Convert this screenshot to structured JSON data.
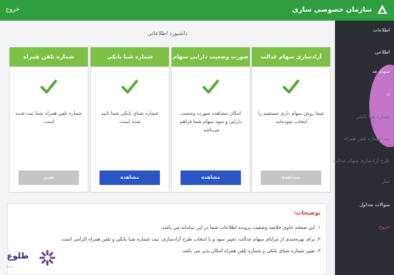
{
  "header": {
    "brand": "سازمان خصوصی سازی",
    "exit": "خروج"
  },
  "sidebar": {
    "items": [
      {
        "label": "اطلاعات",
        "tone": "bright"
      },
      {
        "label": "اطلاعی",
        "tone": "bright"
      },
      {
        "label": "سهام عد",
        "tone": "bright"
      },
      {
        "label": "ن",
        "tone": "bright"
      },
      {
        "label": "شماره شبا بانکی",
        "tone": "dim"
      },
      {
        "label": "ثبت شماره تلفن همراه",
        "tone": "dim"
      },
      {
        "label": "طرح آزادسازی سهام عدالت",
        "tone": "dim"
      },
      {
        "label": "ساز",
        "tone": "dim"
      },
      {
        "label": "سوالات متداول",
        "tone": "bright"
      },
      {
        "label": "خروج",
        "tone": "red"
      }
    ]
  },
  "main": {
    "title": "داشبورد اطلاعاتی",
    "cards": [
      {
        "title": "آزادسازی سهام عدالت",
        "text": "شما روش سهام داری مستقیم را انتخاب نموده‌اید.",
        "button": "مشاهده",
        "button_state": "disabled"
      },
      {
        "title": "صورت وضعیت دارایی سهام",
        "text": "امکان مشاهده صورت وضعیت دارایی و سود سهام شما فراهم می‌باشد.",
        "button": "مشاهده",
        "button_state": "active"
      },
      {
        "title": "شماره شبا بانکی",
        "text": "شماره شبای بانکی شما تایید شده است.",
        "button": "مشاهده",
        "button_state": "active"
      },
      {
        "title": "شماره تلفن همراه",
        "text": "شماره تلفن همراه شما ثبت شده است.",
        "button": "تغییر",
        "button_state": "disabled"
      }
    ],
    "notes": {
      "title": "توضیحات:",
      "lines": [
        "۱. این صفحه حاوی خلاصه وضعیت پرونده اطلاعات شما در این سامانه می باشد.",
        "۲. برای بهره‌مندی از مزایای سهام عدالت، تغییر سود و یا انتخاب طرح آزادسازی، ثبت شماره شبا بانکی و تلفن همراه الزامی است.",
        "۳. تغییر شماره شبای بانکی و شماره تلفن همراه امکان پذیر می باشد."
      ]
    }
  },
  "watermark": {
    "name": "طلوع",
    "subtitle": "پدیده"
  },
  "colors": {
    "header": "#2e9e3f",
    "card_header": "#7cc046",
    "primary_button": "#2a55c2",
    "disabled_button": "#c4c6c8",
    "sidebar": "#2a2d33",
    "notes_title": "#d22a2a"
  }
}
